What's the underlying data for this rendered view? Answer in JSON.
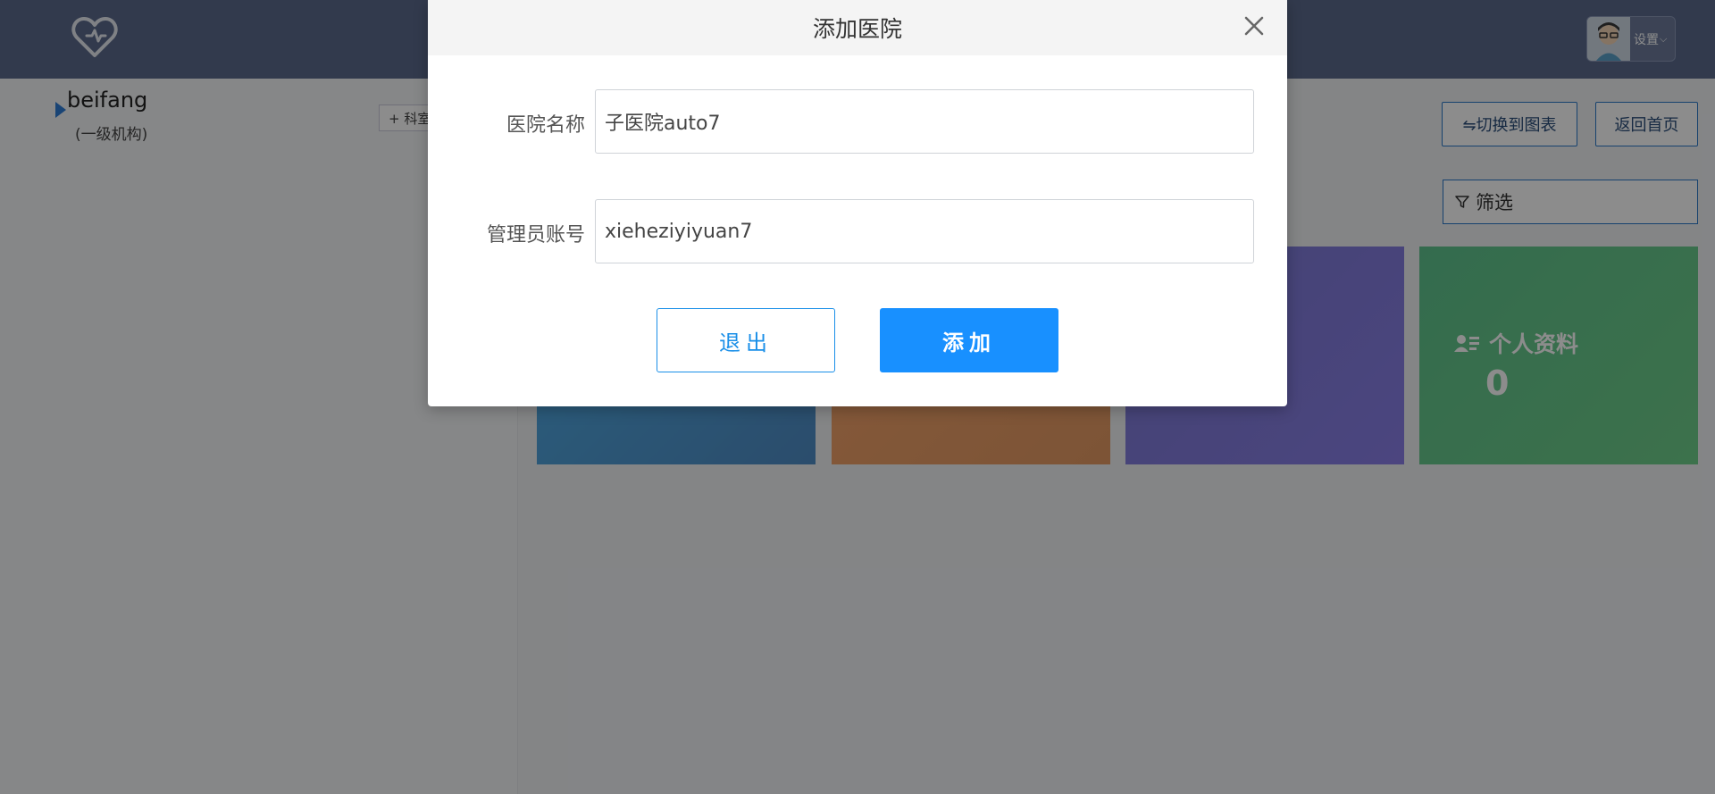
{
  "header": {
    "user_menu_label": "设置"
  },
  "tree": {
    "root_name": "beifang",
    "root_subtitle": "(一级机构)",
    "add_dept_label": "+ 科室"
  },
  "toolbar": {
    "switch_chart_label": "⇋切换到图表",
    "back_home_label": "返回首页",
    "filter_label": "筛选"
  },
  "tiles": [
    {
      "label": "",
      "count": ""
    },
    {
      "label": "",
      "count": ""
    },
    {
      "label": "",
      "count": ""
    },
    {
      "label": "个人资料",
      "count": "0"
    }
  ],
  "modal": {
    "title": "添加医院",
    "hospital_name_label": "医院名称",
    "hospital_name_value": "子医院auto7",
    "admin_account_label": "管理员账号",
    "admin_account_value": "xieheziyiyuan7",
    "cancel_label": "退出",
    "add_label": "添加"
  },
  "colors": {
    "header_bg": "#5b6a8d",
    "primary": "#1890ff",
    "tile_blue": "#4f9fd9",
    "tile_orange": "#f0a068",
    "tile_purple": "#7f7ddb",
    "tile_green": "#66c98b"
  }
}
